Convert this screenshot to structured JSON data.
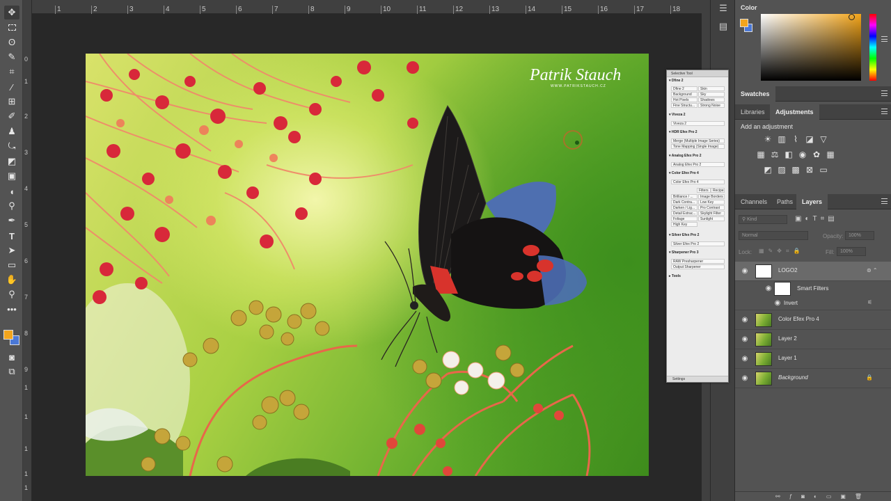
{
  "ruler_h_numbers": [
    "1",
    "2",
    "3",
    "4",
    "5",
    "6",
    "7",
    "8",
    "9",
    "10",
    "11",
    "12",
    "13",
    "14",
    "15",
    "16",
    "17",
    "18"
  ],
  "ruler_v_numbers": [
    "0",
    "1",
    "2",
    "3",
    "4",
    "5",
    "6",
    "7",
    "8",
    "9",
    "1",
    "1",
    "1",
    "1",
    "1"
  ],
  "watermark": {
    "name": "Patrik Stauch",
    "url": "WWW.PATRIKSTAUCH.CZ"
  },
  "colors": {
    "foreground": "#f2a51d",
    "background": "#4a78d6"
  },
  "color_panel": {
    "title": "Color"
  },
  "swatches_panel": {
    "title": "Swatches"
  },
  "adjustments_panel": {
    "tab_libraries": "Libraries",
    "tab_adjustments": "Adjustments",
    "add_label": "Add an adjustment"
  },
  "layers_panel": {
    "tab_channels": "Channels",
    "tab_paths": "Paths",
    "tab_layers": "Layers",
    "filter_kind": "Kind",
    "blend_mode": "Normal",
    "opacity_label": "Opacity:",
    "opacity_value": "100%",
    "lock_label": "Lock:",
    "fill_label": "Fill:",
    "fill_value": "100%",
    "layers": [
      {
        "name": "LOGO2"
      },
      {
        "name": "Smart Filters"
      },
      {
        "name": "Invert"
      },
      {
        "name": "Color Efex Pro 4"
      },
      {
        "name": "Layer 2"
      },
      {
        "name": "Layer 1"
      },
      {
        "name": "Background"
      }
    ]
  },
  "selective_tool": {
    "title": "Selective Tool",
    "sections": [
      {
        "title": "Dfine 2",
        "buttons": [
          "Dfine 2",
          "Skin",
          "Background",
          "Sky",
          "Hot Pixels",
          "Shadows",
          "Fine Structu...",
          "Strong Noise"
        ]
      },
      {
        "title": "Viveza 2",
        "buttons": [
          "Viveza 2"
        ]
      },
      {
        "title": "HDR Efex Pro 2",
        "buttons": [
          "Merge (Multiple Image Series)",
          "Tone Mapping (Single Image)"
        ]
      },
      {
        "title": "Analog Efex Pro 2",
        "buttons": [
          "Analog Efex Pro 2"
        ]
      },
      {
        "title": "Color Efex Pro 4",
        "buttons": [
          "Color Efex Pro 4",
          "Filters",
          "Recipes",
          "Brilliance / ...",
          "Image Borders",
          "Dark Contra...",
          "Low Key",
          "Darken / Lig...",
          "Pro Contrast",
          "Detail Extrac...",
          "Skylight Filter",
          "Foliage",
          "Sunlight",
          "High Key"
        ]
      },
      {
        "title": "Silver Efex Pro 2",
        "buttons": [
          "Silver Efex Pro 2"
        ]
      },
      {
        "title": "Sharpener Pro 3",
        "buttons": [
          "RAW Presharpener",
          "Output Sharpener"
        ]
      },
      {
        "title": "Tools",
        "buttons": []
      }
    ],
    "footer": "Settings"
  }
}
